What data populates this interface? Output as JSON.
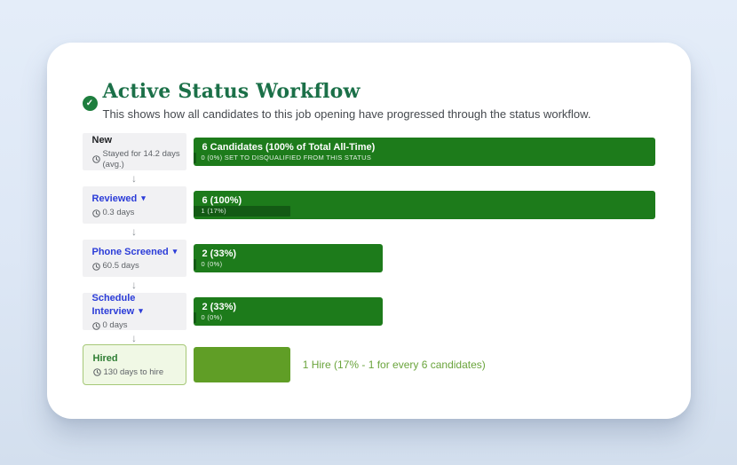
{
  "page": {
    "title": "Active Status Workflow",
    "description": "This shows how all candidates to this job opening have progressed through the status workflow."
  },
  "icons": {
    "header_check": "✓",
    "caret_down": "▾",
    "arrow_down": "↓",
    "clock": "clock-icon"
  },
  "colors": {
    "title_green": "#1b7048",
    "check_badge_green": "#1e7e3e",
    "bar_green": "#1d7b1b",
    "sub_bar_dark_green": "#135a14",
    "hired_bar_olive": "#609e26",
    "hired_box_bg": "#f0f8e5",
    "hired_box_border": "#a6c878",
    "hired_text_green": "#2e7d33",
    "status_link_blue": "#2b3cd8",
    "summary_text_green": "#6aa43c",
    "status_box_grey": "#f1f1f3",
    "background_blue": "#e4edf9"
  },
  "rows": [
    {
      "id": "new",
      "label": "New",
      "dropdown": false,
      "meta": "Stayed for 14.2 days (avg.)",
      "bar": {
        "label": "6 Candidates (100% of Total All-Time)",
        "width_pct": 100,
        "sub": {
          "label": "0 (0%) SET TO DISQUALIFIED FROM THIS STATUS",
          "width_pct": 0.6
        }
      },
      "arrow_after": true
    },
    {
      "id": "reviewed",
      "label": "Reviewed",
      "dropdown": true,
      "meta": "0.3 days",
      "bar": {
        "label": "6 (100%)",
        "width_pct": 100,
        "sub": {
          "label": "1 (17%)",
          "width_pct": 21
        }
      },
      "arrow_after": true
    },
    {
      "id": "phone-screened",
      "label": "Phone Screened",
      "dropdown": true,
      "meta": "60.5 days",
      "bar": {
        "label": "2 (33%)",
        "width_pct": 41,
        "sub": {
          "label": "0 (0%)",
          "width_pct": 0.8
        }
      },
      "arrow_after": true
    },
    {
      "id": "schedule-interview",
      "label": "Schedule Interview",
      "dropdown": true,
      "meta": "0 days",
      "bar": {
        "label": "2 (33%)",
        "width_pct": 41,
        "sub": {
          "label": "0 (0%)",
          "width_pct": 0.8
        }
      },
      "arrow_after": true
    },
    {
      "id": "hired",
      "label": "Hired",
      "dropdown": false,
      "variant": "hired",
      "meta": "130 days to hire",
      "bar": {
        "label": "",
        "width_pct": 21,
        "sub": null
      },
      "right_label": "1 Hire (17% - 1 for every 6 candidates)",
      "arrow_after": false
    }
  ]
}
